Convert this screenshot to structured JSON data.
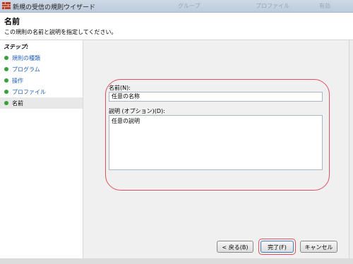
{
  "window": {
    "title": "新規の受信の規則ウイザード",
    "background_tabs": [
      "グループ",
      "プロファイル",
      "有効"
    ]
  },
  "header": {
    "title": "名前",
    "subtitle": "この規則の名前と説明を指定してください。"
  },
  "sidebar": {
    "steps_label": "ステップ:",
    "items": [
      {
        "label": "規則の種類",
        "active": false
      },
      {
        "label": "プログラム",
        "active": false
      },
      {
        "label": "操作",
        "active": false
      },
      {
        "label": "プロファイル",
        "active": false
      },
      {
        "label": "名前",
        "active": true
      }
    ],
    "step_dot_color": "#3aa13a"
  },
  "form": {
    "name_label": "名前(N):",
    "name_value": "任意の名称",
    "desc_label": "説明 (オプション)(D):",
    "desc_value": "任意の説明"
  },
  "buttons": {
    "back": "< 戻る(B)",
    "finish": "完了(F)",
    "cancel": "キャンセル"
  },
  "colors": {
    "highlight": "#e05060",
    "link": "#1f5fb8"
  }
}
